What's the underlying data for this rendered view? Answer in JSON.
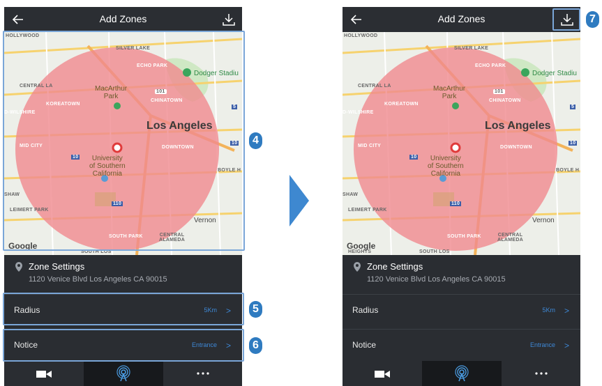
{
  "screen_left": {
    "header": {
      "title": "Add Zones"
    },
    "map": {
      "labels": {
        "hollywood": "HOLLYWOOD",
        "silver_lake": "SILVER LAKE",
        "echo_park": "ECHO PARK",
        "central_la": "CENTRAL LA",
        "koreatown": "KOREATOWN",
        "chinatown": "CHINATOWN",
        "wilshire": "D-WILSHIRE",
        "mid_city": "MID CITY",
        "downtown": "DOWNTOWN",
        "boyle": "BOYLE H",
        "shaw": "SHAW",
        "leimert": "LEIMERT PARK",
        "south_park": "SOUTH PARK",
        "central_alameda": "CENTRAL\nALAMEDA",
        "south_los": "SOUTH LOS"
      },
      "city": "Los Angeles",
      "poi_macarthur": "MacArthur\nPark",
      "poi_dodger": "Dodger Stadiu",
      "poi_usc": "University\nof Southern\nCalifornia",
      "vernon": "Vernon",
      "google": "Google",
      "shields": {
        "a": "101",
        "b": "10",
        "c": "110",
        "d": "5",
        "e": "10"
      }
    },
    "zone_settings": {
      "title": "Zone Settings",
      "address": "1120 Venice Blvd Los Angeles CA 90015"
    },
    "radius": {
      "label": "Radius",
      "value": "5Km",
      "chevron": ">"
    },
    "notice": {
      "label": "Notice",
      "value": "Entrance",
      "chevron": ">"
    }
  },
  "screen_right": {
    "header": {
      "title": "Add Zones"
    },
    "map": {
      "labels": {
        "hollywood": "HOLLYWOOD",
        "silver_lake": "SILVER LAKE",
        "echo_park": "ECHO PARK",
        "central_la": "CENTRAL LA",
        "koreatown": "KOREATOWN",
        "chinatown": "CHINATOWN",
        "wilshire": "D-WILSHIRE",
        "mid_city": "MID CITY",
        "downtown": "DOWNTOWN",
        "boyle": "BOYLE H",
        "shaw": "SHAW",
        "leimert": "LEIMERT PARK",
        "south_park": "SOUTH PARK",
        "central_alameda": "CENTRAL\nALAMEDA",
        "south_los": "SOUTH LOS",
        "heights": "HEIGHTS"
      },
      "city": "Los Angeles",
      "poi_macarthur": "MacArthur\nPark",
      "poi_dodger": "Dodger Stadiu",
      "poi_usc": "University\nof Southern\nCalifornia",
      "vernon": "Vernon",
      "google": "Google",
      "shields": {
        "a": "101",
        "b": "10",
        "c": "110",
        "d": "5",
        "e": "10"
      }
    },
    "zone_settings": {
      "title": "Zone Settings",
      "address": "1120 Venice Blvd Los Angeles CA 90015"
    },
    "radius": {
      "label": "Radius",
      "value": "5Km",
      "chevron": ">"
    },
    "notice": {
      "label": "Notice",
      "value": "Entrance",
      "chevron": ">"
    }
  },
  "callouts": {
    "four": "4",
    "five": "5",
    "six": "6",
    "seven": "7"
  },
  "colors": {
    "accent": "#3e88d6",
    "callout": "#2f7bc0",
    "zone_fill": "#f08a8f",
    "outline": "#7aa6d8"
  }
}
